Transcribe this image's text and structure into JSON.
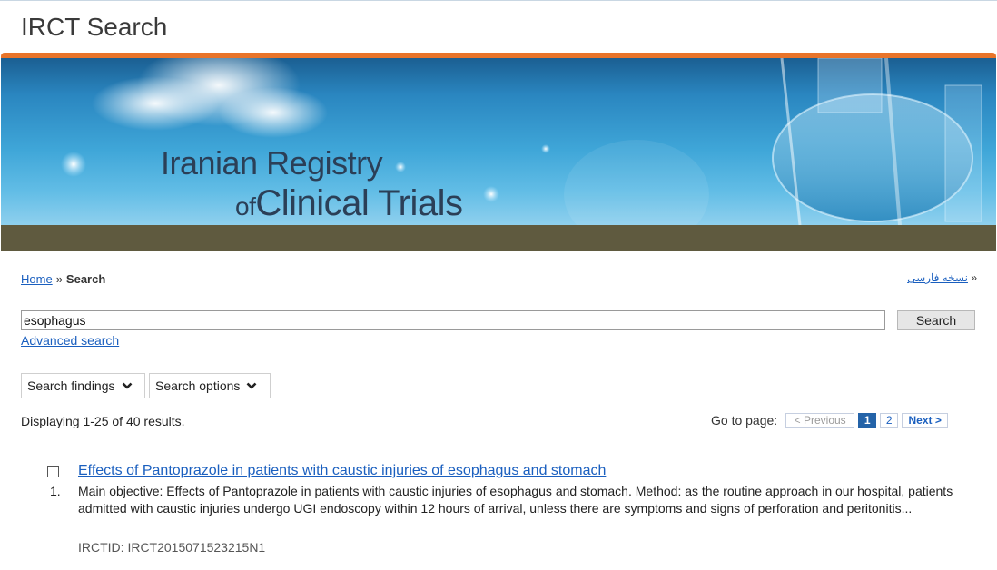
{
  "page": {
    "title": "IRCT Search"
  },
  "banner": {
    "line1": "Iranian Registry",
    "line2_small": "of",
    "line2": "Clinical Trials"
  },
  "breadcrumb": {
    "home": "Home",
    "separator": "»",
    "current": "Search"
  },
  "language": {
    "link": "نسخه فارسی",
    "marker": "»"
  },
  "search": {
    "value": "esophagus",
    "button": "Search",
    "advanced": "Advanced search"
  },
  "filters": {
    "findings": "Search findings",
    "options": "Search options"
  },
  "results": {
    "summary": "Displaying 1-25 of 40 results.",
    "pager": {
      "label": "Go to page:",
      "previous": "< Previous",
      "current": "1",
      "page2": "2",
      "next": "Next >"
    },
    "items": [
      {
        "number": "1.",
        "title": "Effects of Pantoprazole in patients with caustic injuries of esophagus and stomach",
        "summary": "Main objective: Effects of Pantoprazole in patients with caustic injuries of esophagus and stomach. Method: as the routine approach in our hospital, patients admitted with caustic injuries undergo UGI endoscopy within 12 hours of arrival, unless there are symptoms and signs of perforation and peritonitis...",
        "id": "IRCTID: IRCT2015071523215N1"
      }
    ]
  },
  "colors": {
    "accent_orange": "#e8742a",
    "link": "#1a5fbf",
    "banner_bottom": "#5f5a3f"
  }
}
